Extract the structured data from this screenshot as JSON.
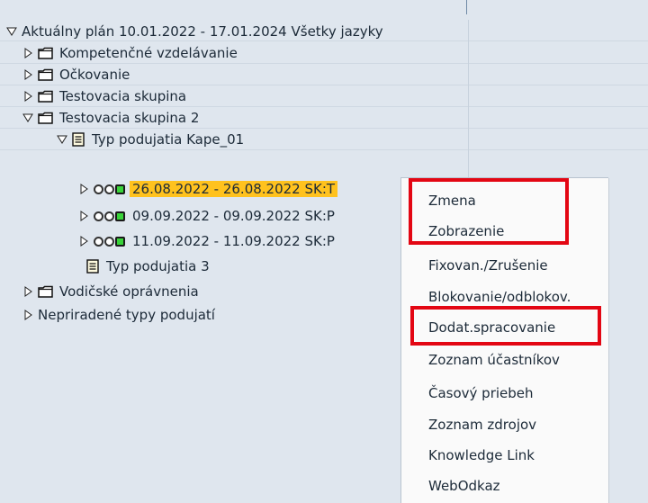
{
  "tree": {
    "root": {
      "label": "Aktuálny plán 10.01.2022 - 17.01.2024 Všetky jazyky"
    },
    "items": [
      {
        "label": "Kompetenčné vzdelávanie"
      },
      {
        "label": "Očkovanie"
      },
      {
        "label": "Testovacia skupina"
      },
      {
        "label": "Testovacia skupina 2"
      },
      {
        "label": "Typ podujatia Kape_01"
      },
      {
        "label": "26.08.2022 - 26.08.2022 SK:T"
      },
      {
        "label": "09.09.2022 - 09.09.2022 SK:P"
      },
      {
        "label": "11.09.2022 - 11.09.2022 SK:P"
      },
      {
        "label": "Typ podujatia 3"
      },
      {
        "label": "Vodičské oprávnenia"
      },
      {
        "label": "Nepriradené typy podujatí"
      }
    ]
  },
  "context_menu": {
    "items": [
      "Zmena",
      "Zobrazenie",
      "Fixovan./Zrušenie",
      "Blokovanie/odblokov.",
      "Dodat.spracovanie",
      "Zoznam účastníkov",
      "Časový priebeh",
      "Zoznam zdrojov",
      "Knowledge Link",
      "WebOdkaz"
    ]
  },
  "colors": {
    "background": "#dfe6ee",
    "selection": "#ffc21e",
    "highlight_box": "#e30613",
    "traffic_light_green": "#39d339"
  }
}
